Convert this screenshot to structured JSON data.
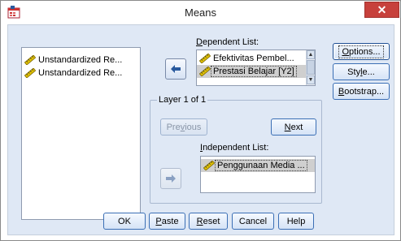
{
  "window": {
    "title": "Means",
    "close_label": "✕"
  },
  "source_list": {
    "items": [
      {
        "label": "Unstandardized Re..."
      },
      {
        "label": "Unstandardized Re..."
      }
    ]
  },
  "dependent": {
    "label_prefix": "",
    "label_underline": "D",
    "label_rest": "ependent List:",
    "items": [
      {
        "label": "Efektivitas Pembel...",
        "selected": false
      },
      {
        "label": "Prestasi Belajar [Y2]",
        "selected": true
      }
    ]
  },
  "layer": {
    "title": "Layer 1 of 1",
    "previous_prefix": "Pre",
    "previous_underline": "v",
    "previous_rest": "ious",
    "next_prefix": "",
    "next_underline": "N",
    "next_rest": "ext",
    "independent_label_prefix": "",
    "independent_label_underline": "I",
    "independent_label_rest": "ndependent List:",
    "independent_items": [
      {
        "label": "Penggunaan Media ...",
        "selected": true
      }
    ]
  },
  "side_buttons": {
    "options_prefix": "",
    "options_underline": "O",
    "options_rest": "ptions...",
    "style_prefix": "Sty",
    "style_underline": "l",
    "style_rest": "e...",
    "bootstrap_prefix": "",
    "bootstrap_underline": "B",
    "bootstrap_rest": "ootstrap..."
  },
  "bottom_buttons": {
    "ok": "OK",
    "paste_prefix": "",
    "paste_underline": "P",
    "paste_rest": "aste",
    "reset_prefix": "",
    "reset_underline": "R",
    "reset_rest": "eset",
    "cancel": "Cancel",
    "help": "Help"
  },
  "colors": {
    "dialog_bg": "#dfe8f5",
    "close_button": "#c7413c",
    "button_border": "#3b6fb5",
    "arrow_icon": "#2a5a9e"
  }
}
